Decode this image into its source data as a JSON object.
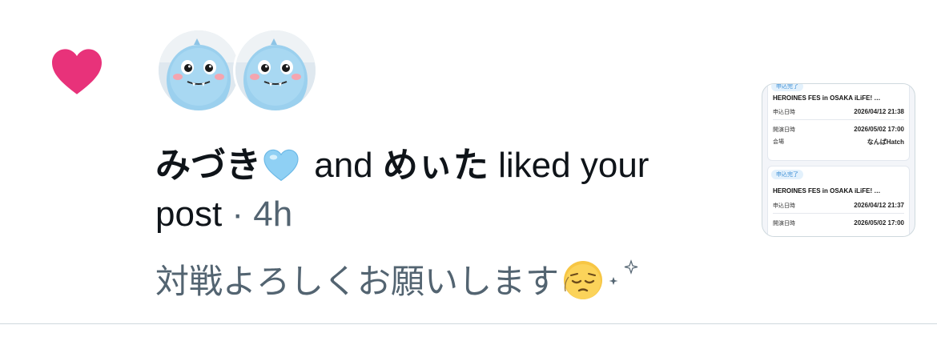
{
  "notification": {
    "type_icon": "heart-icon",
    "accent_color": "#e8327a",
    "user_1": {
      "name": "みづき",
      "name_emoji": "light-blue-heart-emoji"
    },
    "connector": "and",
    "user_2": {
      "name": "めぃた"
    },
    "action": "liked your post",
    "separator": "·",
    "time": "4h",
    "post_text": "対戦よろしくお願いします",
    "post_emoji": "pensive-face-emoji",
    "post_sparkles": "sparkles-emoji"
  },
  "avatars": [
    {
      "icon": "blue-monster-mascot-avatar"
    },
    {
      "icon": "blue-monster-mascot-avatar"
    }
  ],
  "thumbnail": {
    "cards": [
      {
        "badge": "申込完了",
        "title": "HEROINES FES in OSAKA iLiFE! …",
        "rows": [
          {
            "label": "申込日時",
            "value": "2026/04/12 21:38"
          },
          {
            "label": "開演日時",
            "value": "2026/05/02 17:00"
          },
          {
            "label": "会場",
            "value": "なんばHatch"
          }
        ]
      },
      {
        "badge": "申込完了",
        "title": "HEROINES FES in OSAKA iLiFE! …",
        "rows": [
          {
            "label": "申込日時",
            "value": "2026/04/12 21:37"
          },
          {
            "label": "開演日時",
            "value": "2026/05/02 17:00"
          }
        ]
      }
    ]
  }
}
